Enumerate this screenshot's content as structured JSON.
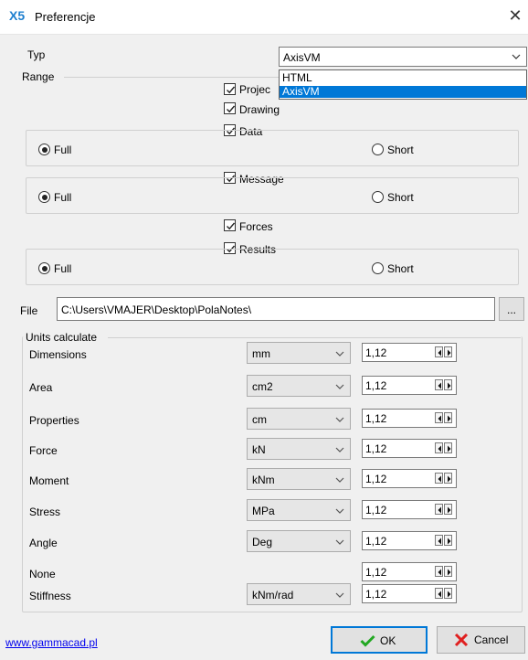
{
  "window": {
    "title": "Preferencje",
    "logo": "X5",
    "close_icon": "close-icon"
  },
  "typ": {
    "label": "Typ",
    "selected": "AxisVM",
    "options": [
      "HTML",
      "AxisVM"
    ]
  },
  "range": {
    "label": "Range",
    "checkboxes": {
      "project": "Projec",
      "drawing": "Drawing",
      "data": "Data",
      "message": "Message",
      "forces": "Forces",
      "results": "Results"
    },
    "radio_full": "Full",
    "radio_short": "Short"
  },
  "file": {
    "label": "File",
    "path": "C:\\Users\\VMAJER\\Desktop\\PolaNotes\\",
    "browse_label": "..."
  },
  "units": {
    "label": "Units calculate",
    "rows": [
      {
        "name": "Dimensions",
        "unit": "mm",
        "precision": "1,12"
      },
      {
        "name": "Area",
        "unit": "cm2",
        "precision": "1,12"
      },
      {
        "name": "Properties",
        "unit": "cm",
        "precision": "1,12"
      },
      {
        "name": "Force",
        "unit": "kN",
        "precision": "1,12"
      },
      {
        "name": "Moment",
        "unit": "kNm",
        "precision": "1,12"
      },
      {
        "name": "Stress",
        "unit": "MPa",
        "precision": "1,12"
      },
      {
        "name": "Angle",
        "unit": "Deg",
        "precision": "1,12"
      },
      {
        "name": "None",
        "unit": "",
        "precision": "1,12"
      },
      {
        "name": "Stiffness",
        "unit": "kNm/rad",
        "precision": "1,12"
      }
    ]
  },
  "footer": {
    "link": "www.gammacad.pl",
    "ok_label": "OK",
    "cancel_label": "Cancel"
  },
  "colors": {
    "accent": "#0078d7",
    "ok_check": "#22a822",
    "cancel_x": "#e02020"
  }
}
